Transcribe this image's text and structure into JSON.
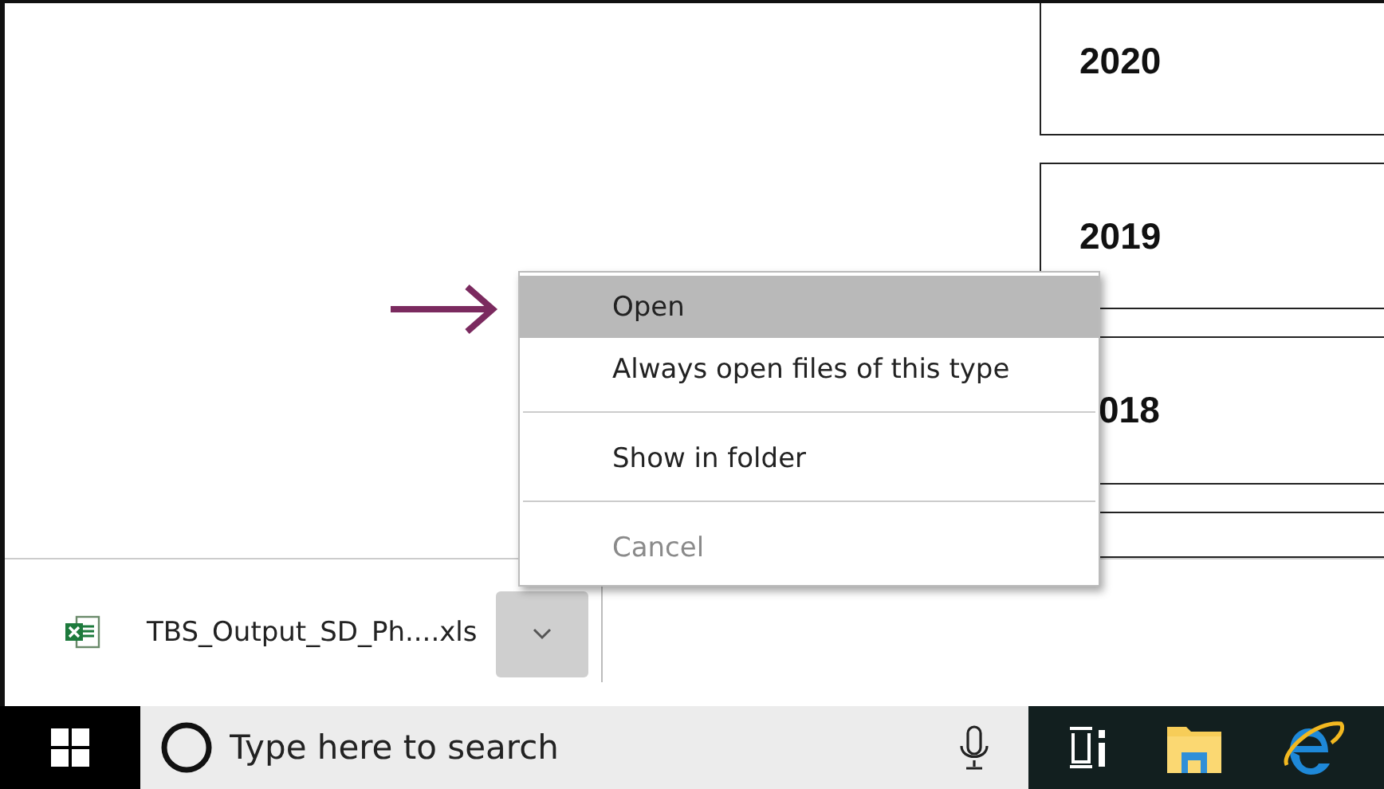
{
  "year_cards": [
    {
      "year": "2020"
    },
    {
      "year": "2019"
    },
    {
      "year": "018"
    }
  ],
  "context_menu": {
    "items": [
      {
        "kind": "item",
        "label": "Open",
        "selected": true,
        "disabled": false
      },
      {
        "kind": "item",
        "label": "Always open files of this type",
        "selected": false,
        "disabled": false
      },
      {
        "kind": "separator"
      },
      {
        "kind": "item",
        "label": "Show in folder",
        "selected": false,
        "disabled": false
      },
      {
        "kind": "separator"
      },
      {
        "kind": "item",
        "label": "Cancel",
        "selected": false,
        "disabled": true
      }
    ]
  },
  "download_bar": {
    "file_name": "TBS_Output_SD_Ph....xls"
  },
  "taskbar": {
    "search": {
      "placeholder": "Type here to search"
    }
  }
}
